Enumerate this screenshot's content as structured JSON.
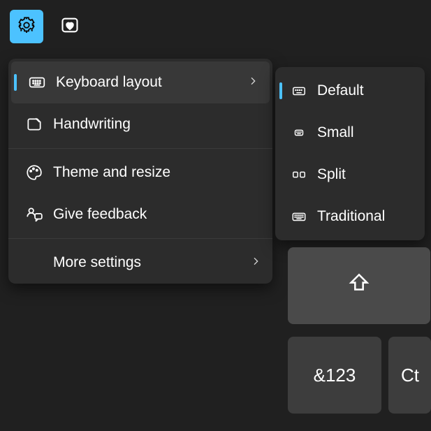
{
  "toolbar": {
    "settings_icon": "gear",
    "gif_icon": "gif-heart"
  },
  "menu": {
    "items": [
      {
        "label": "Keyboard layout",
        "has_submenu": true,
        "selected": true
      },
      {
        "label": "Handwriting"
      },
      {
        "label": "Theme and resize"
      },
      {
        "label": "Give feedback"
      },
      {
        "label": "More settings",
        "has_submenu": true
      }
    ]
  },
  "submenu": {
    "items": [
      {
        "label": "Default",
        "selected": true
      },
      {
        "label": "Small"
      },
      {
        "label": "Split"
      },
      {
        "label": "Traditional"
      }
    ]
  },
  "keys": {
    "symbols": "&123",
    "ctrl": "Ct"
  }
}
